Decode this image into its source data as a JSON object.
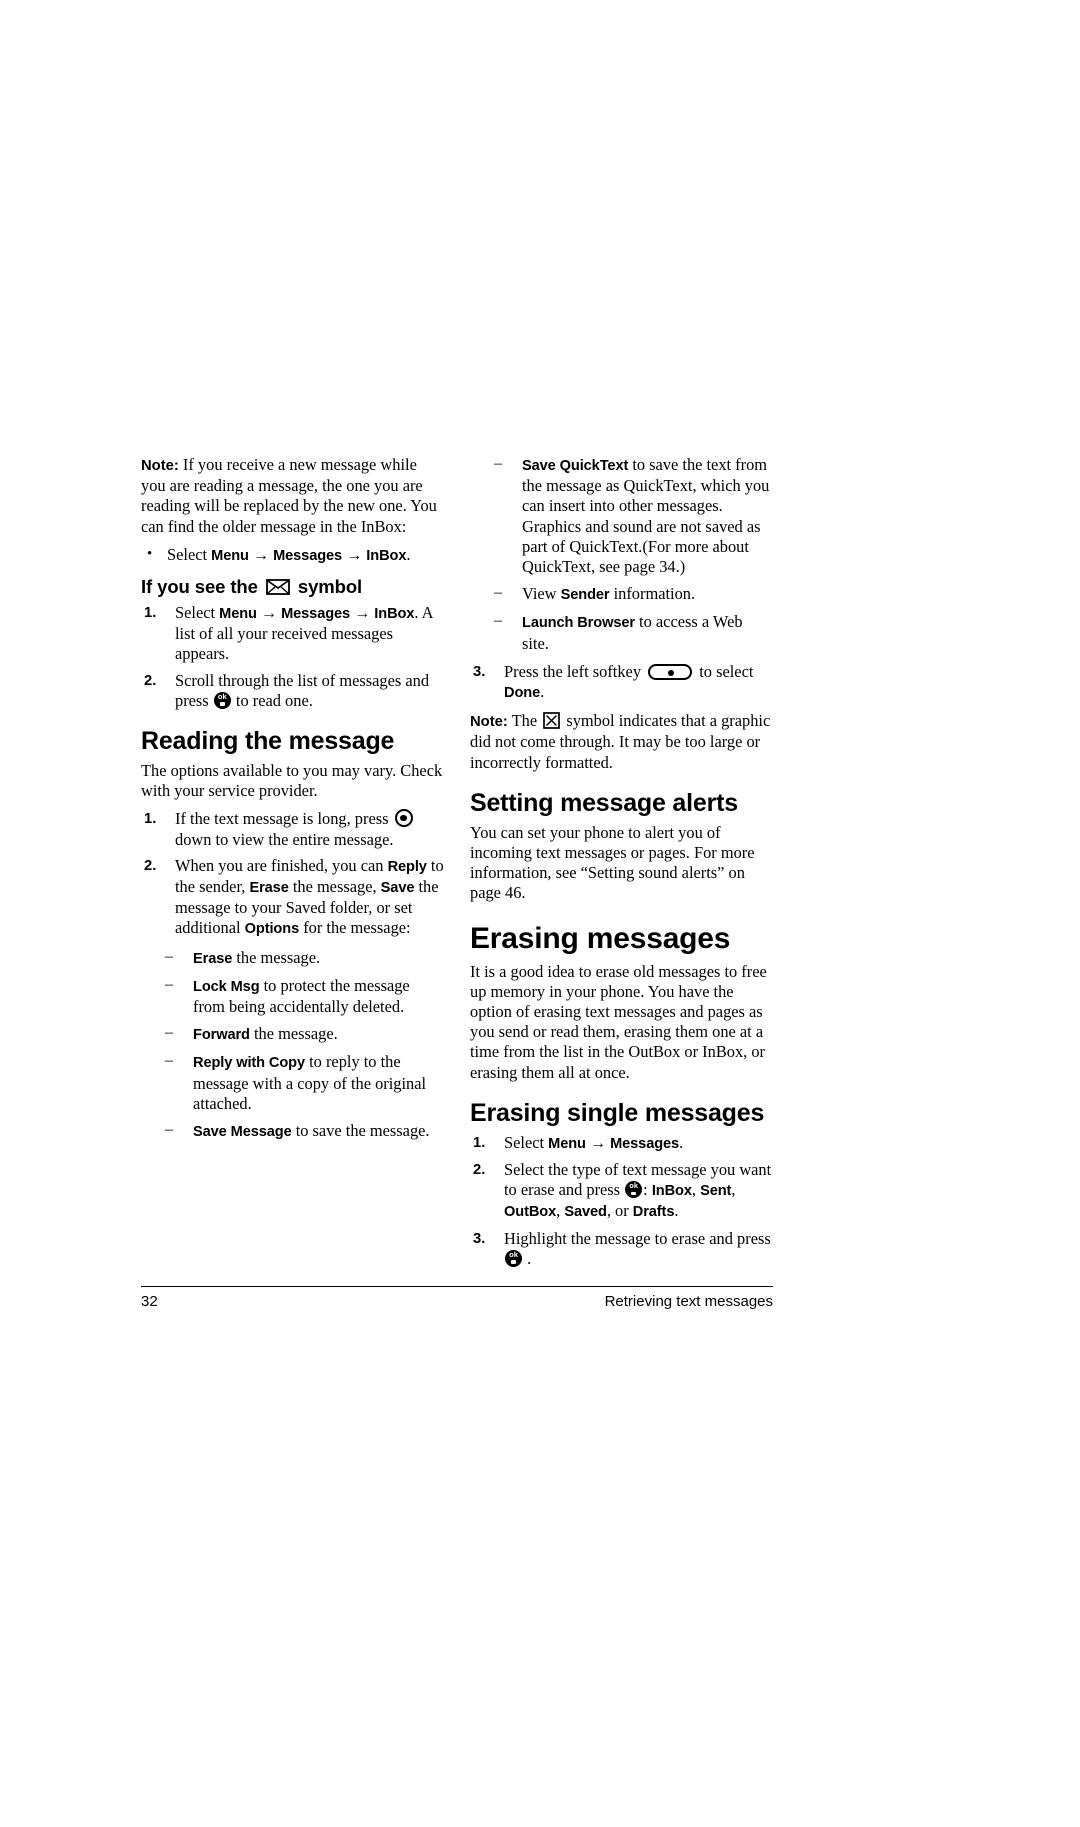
{
  "page": {
    "number": "32",
    "running_header": "Retrieving text messages"
  },
  "icons": {
    "ok_key": "ok-key-icon",
    "nav_key": "navigation-key-icon",
    "softkey": "left-softkey-icon",
    "envelope": "envelope-icon",
    "broken_image": "broken-image-icon"
  },
  "left_column": {
    "note_intro": {
      "label": "Note:",
      "text": "If you receive a new message while you are reading a message, the one you are reading will be replaced by the new one. You can find the older message in the InBox:"
    },
    "note_bullet": {
      "marker": "•",
      "lead": "Select",
      "item1": "Menu",
      "arrow1": "→",
      "item2": "Messages",
      "arrow2": "→",
      "item3": "InBox",
      "tail": "."
    },
    "heading_symbol": {
      "before": "If you see the",
      "after": "symbol"
    },
    "symbol_steps": [
      {
        "marker": "1.",
        "lead": "Select",
        "item1": "Menu",
        "arrow1": "→",
        "item2": "Messages",
        "arrow2": "→",
        "item3": "InBox",
        "tail": ". A list of all your received messages appears."
      },
      {
        "marker": "2.",
        "before": "Scroll through the list of messages and press",
        "after": "to read one."
      }
    ],
    "heading_reading": "Reading the message",
    "reading_intro": "The options available to you may vary. Check with your service provider.",
    "reading_steps": [
      {
        "marker": "1.",
        "before": "If the text message is long, press",
        "after": "down to view the entire message."
      },
      {
        "marker": "2.",
        "part1": "When you are finished, you can ",
        "b1": "Reply",
        "part2": " to the sender, ",
        "b2": "Erase",
        "part3": " the message, ",
        "b3": "Save",
        "part4": " the message to your Saved folder, or set additional ",
        "b4": "Options",
        "part5": " for the message:"
      }
    ],
    "options": [
      {
        "marker": "–",
        "bold": "Erase",
        "rest": " the message."
      },
      {
        "marker": "–",
        "bold": "Lock Msg",
        "rest": " to protect the message from being accidentally deleted."
      },
      {
        "marker": "–",
        "bold": "Forward",
        "rest": " the message."
      },
      {
        "marker": "–",
        "bold": "Reply with Copy",
        "rest": " to reply to the message with a copy of the original attached."
      },
      {
        "marker": "–",
        "bold": "Save Message",
        "rest": " to save the message."
      }
    ]
  },
  "right_column": {
    "options_continued": [
      {
        "marker": "–",
        "bold": "Save QuickText",
        "rest": " to save the text from the message as QuickText, which you can insert into other messages. Graphics and sound are not saved as part of QuickText.(For more about QuickText, see page 34.)"
      },
      {
        "marker": "–",
        "before": "View ",
        "bold": "Sender",
        "rest": " information."
      },
      {
        "marker": "–",
        "bold": "Launch Browser",
        "rest": " to access a Web site."
      }
    ],
    "step3": {
      "marker": "3.",
      "before": "Press the left softkey",
      "middle": "to select",
      "bold": "Done",
      "tail": "."
    },
    "note_broken": {
      "label": "Note:",
      "before": "The",
      "after": "symbol indicates that a graphic did not come through. It may be too large or incorrectly formatted."
    },
    "heading_alerts": "Setting message alerts",
    "alerts_body": "You can set your phone to alert you of incoming text messages or pages. For more information, see “Setting sound alerts” on page 46.",
    "heading_erasing": "Erasing messages",
    "erasing_body": "It is a good idea to erase old messages to free up memory in your phone. You have the option of erasing text messages and pages as you send or read them, erasing them one at a time from the list in the OutBox or InBox, or erasing them all at once.",
    "heading_erasing_single": "Erasing single messages",
    "erasing_steps": [
      {
        "marker": "1.",
        "lead": "Select",
        "item1": "Menu",
        "arrow1": "→",
        "item2": "Messages",
        "tail": "."
      },
      {
        "marker": "2.",
        "before": "Select the type of text message you want to erase and press",
        "sep": ": ",
        "o1": "InBox",
        "c1": ", ",
        "o2": "Sent",
        "c2": ", ",
        "o3": "OutBox",
        "c3": ", ",
        "o4": "Saved",
        "c4": ", or ",
        "o5": "Drafts",
        "tail": "."
      },
      {
        "marker": "3.",
        "before": "Highlight the message to erase and press",
        "after": "."
      }
    ]
  }
}
